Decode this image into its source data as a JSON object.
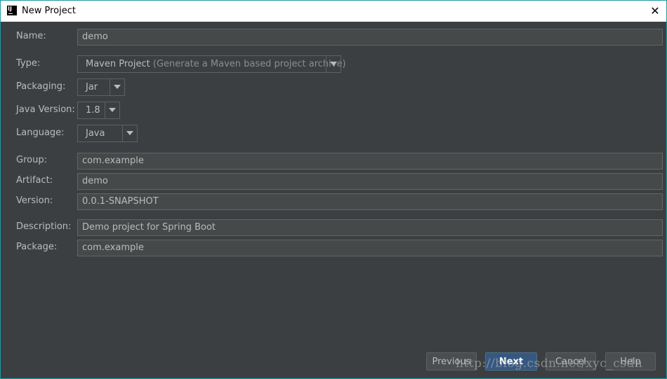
{
  "window": {
    "title": "New Project",
    "close_glyph": "✕",
    "app_icon": "intellij-idea-icon"
  },
  "form": {
    "name": {
      "label": "Name:",
      "value": "demo"
    },
    "type": {
      "label": "Type:",
      "value": "Maven Project",
      "hint": "(Generate a Maven based project archive)"
    },
    "packaging": {
      "label": "Packaging:",
      "value": "Jar"
    },
    "java_version": {
      "label": "Java Version:",
      "value": "1.8"
    },
    "language": {
      "label": "Language:",
      "value": "Java"
    },
    "group": {
      "label": "Group:",
      "value": "com.example"
    },
    "artifact": {
      "label": "Artifact:",
      "value": "demo"
    },
    "version": {
      "label": "Version:",
      "value": "0.0.1-SNAPSHOT"
    },
    "description": {
      "label": "Description:",
      "value": "Demo project for Spring Boot"
    },
    "package": {
      "label": "Package:",
      "value": "com.example"
    }
  },
  "buttons": {
    "previous": "Previous",
    "next": "Next",
    "cancel": "Cancel",
    "help": "Help"
  },
  "watermark": "http://blog.csdn.net/xyc_csdn",
  "colors": {
    "background": "#3c3f41",
    "field": "#45494a",
    "default_button": "#365880",
    "border_accent": "#1f9ba0"
  }
}
